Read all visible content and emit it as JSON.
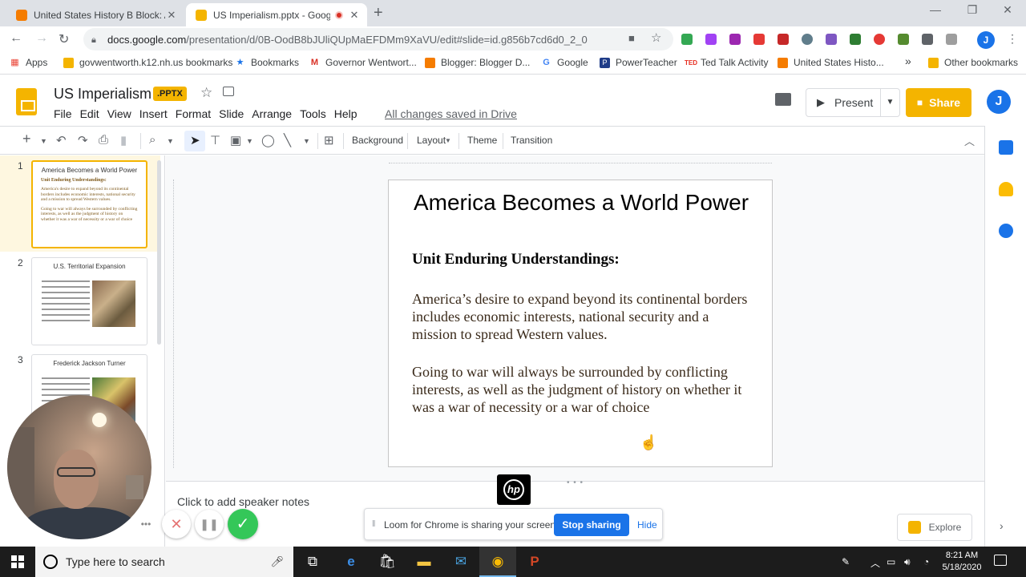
{
  "browser": {
    "tabs": [
      {
        "title": "United States History B Block: An",
        "favicon_color": "#f57c00"
      },
      {
        "title": "US Imperialism.pptx - Googl",
        "favicon_color": "#f4b400"
      }
    ],
    "new_tab_symbol": "+",
    "window_controls": {
      "minimize": "—",
      "restore": "❐",
      "close": "✕"
    },
    "url_main": "docs.google.com",
    "url_path": "/presentation/d/0B-OodB8bJUliQUpMaEFDMm9XaVU/edit#slide=id.g856b7cd6d0_2_0",
    "profile_initial": "J",
    "bookmarks": [
      {
        "label": "Apps",
        "icon": "apps-grid-icon",
        "color": "#ea4335"
      },
      {
        "label": "govwentworth.k12.nh.us bookmarks",
        "icon": "folder-icon",
        "color": "#f4b400"
      },
      {
        "label": "Bookmarks",
        "icon": "star-icon",
        "color": "#1a73e8"
      },
      {
        "label": "Governor Wentwort...",
        "icon": "gmail-icon",
        "color": "#d93025"
      },
      {
        "label": "Blogger: Blogger D...",
        "icon": "blogger-icon",
        "color": "#f57c00"
      },
      {
        "label": "Google",
        "icon": "google-icon",
        "color": "#4285f4"
      },
      {
        "label": "PowerTeacher",
        "icon": "powerteacher-icon",
        "color": "#1f3c88"
      },
      {
        "label": "Ted Talk Activity",
        "icon": "ted-icon",
        "color": "#e62b1e"
      },
      {
        "label": "United States Histo...",
        "icon": "blogger-icon",
        "color": "#f57c00"
      }
    ],
    "bookmarks_overflow": "»",
    "other_bookmarks": "Other bookmarks"
  },
  "slides": {
    "doc_title": "US Imperialism",
    "badge": ".PPTX",
    "saved_status": "All changes saved in Drive",
    "menus": [
      "File",
      "Edit",
      "View",
      "Insert",
      "Format",
      "Slide",
      "Arrange",
      "Tools",
      "Help"
    ],
    "present_label": "Present",
    "share_label": "Share",
    "profile_initial": "J",
    "toolbar": {
      "background": "Background",
      "layout": "Layout",
      "theme": "Theme",
      "transition": "Transition"
    },
    "filmstrip": [
      {
        "number": "1",
        "title": "America Becomes a World Power",
        "subtitle": "Unit Enduring Understandings:",
        "body1": "America's desire to expand beyond its continental borders includes economic interests, national security and a mission to spread Western values.",
        "body2": "Going to war will always be surrounded by conflicting interests, as well as the judgment of history on whether it was a war of necessity or a war of choice"
      },
      {
        "number": "2",
        "title": "U.S. Territorial Expansion"
      },
      {
        "number": "3",
        "title": "Frederick Jackson Turner"
      }
    ],
    "current_slide": {
      "title": "America Becomes a World Power",
      "subtitle": "Unit Enduring Understandings:",
      "paragraph1": "America’s desire to expand beyond its continental borders includes economic interests, national security and a mission to spread Western values.",
      "paragraph2": "Going to war will always be surrounded by conflicting interests, as well as the judgment of history on whether it was a war of necessity or a war of choice"
    },
    "speaker_notes_placeholder": "Click to add speaker notes",
    "explore_label": "Explore"
  },
  "loom": {
    "message": "Loom for Chrome is sharing your screen.",
    "stop_label": "Stop sharing",
    "hide_label": "Hide",
    "hp_text": "hp"
  },
  "taskbar": {
    "search_placeholder": "Type here to search",
    "time": "8:21 AM",
    "date": "5/18/2020"
  },
  "colors": {
    "slides_accent": "#f4b400",
    "link_blue": "#1a73e8",
    "loom_done": "#34c759"
  }
}
